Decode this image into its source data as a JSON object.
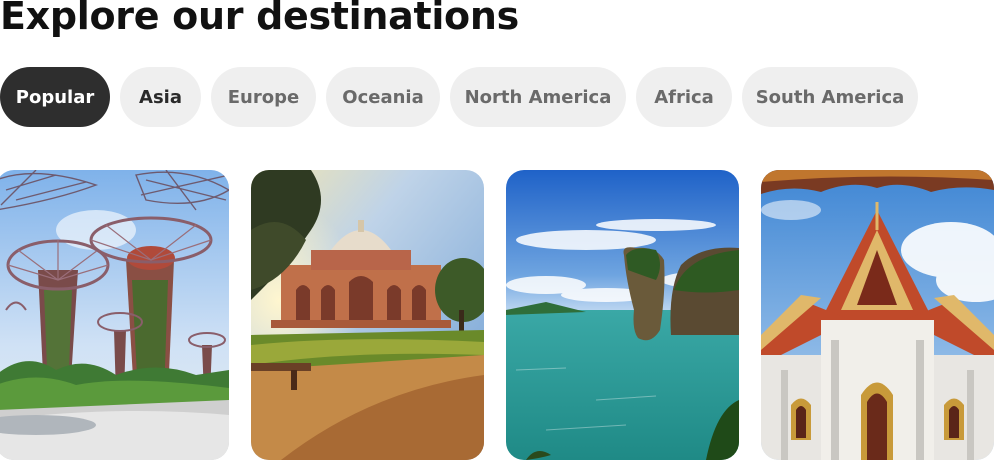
{
  "heading": "Explore our destinations",
  "tabs": [
    {
      "label": "Popular",
      "active": true
    },
    {
      "label": "Asia"
    },
    {
      "label": "Europe"
    },
    {
      "label": "Oceania"
    },
    {
      "label": "North America"
    },
    {
      "label": "Africa"
    },
    {
      "label": "South America"
    }
  ],
  "cards": [
    {
      "image": "gardens-supertree-image"
    },
    {
      "image": "mughal-tomb-image"
    },
    {
      "image": "sea-stack-island-image"
    },
    {
      "image": "thai-temple-image"
    }
  ],
  "colors": {
    "active_tab_bg": "#2e2e2e",
    "tab_bg": "#efefef",
    "heading": "#111111"
  }
}
